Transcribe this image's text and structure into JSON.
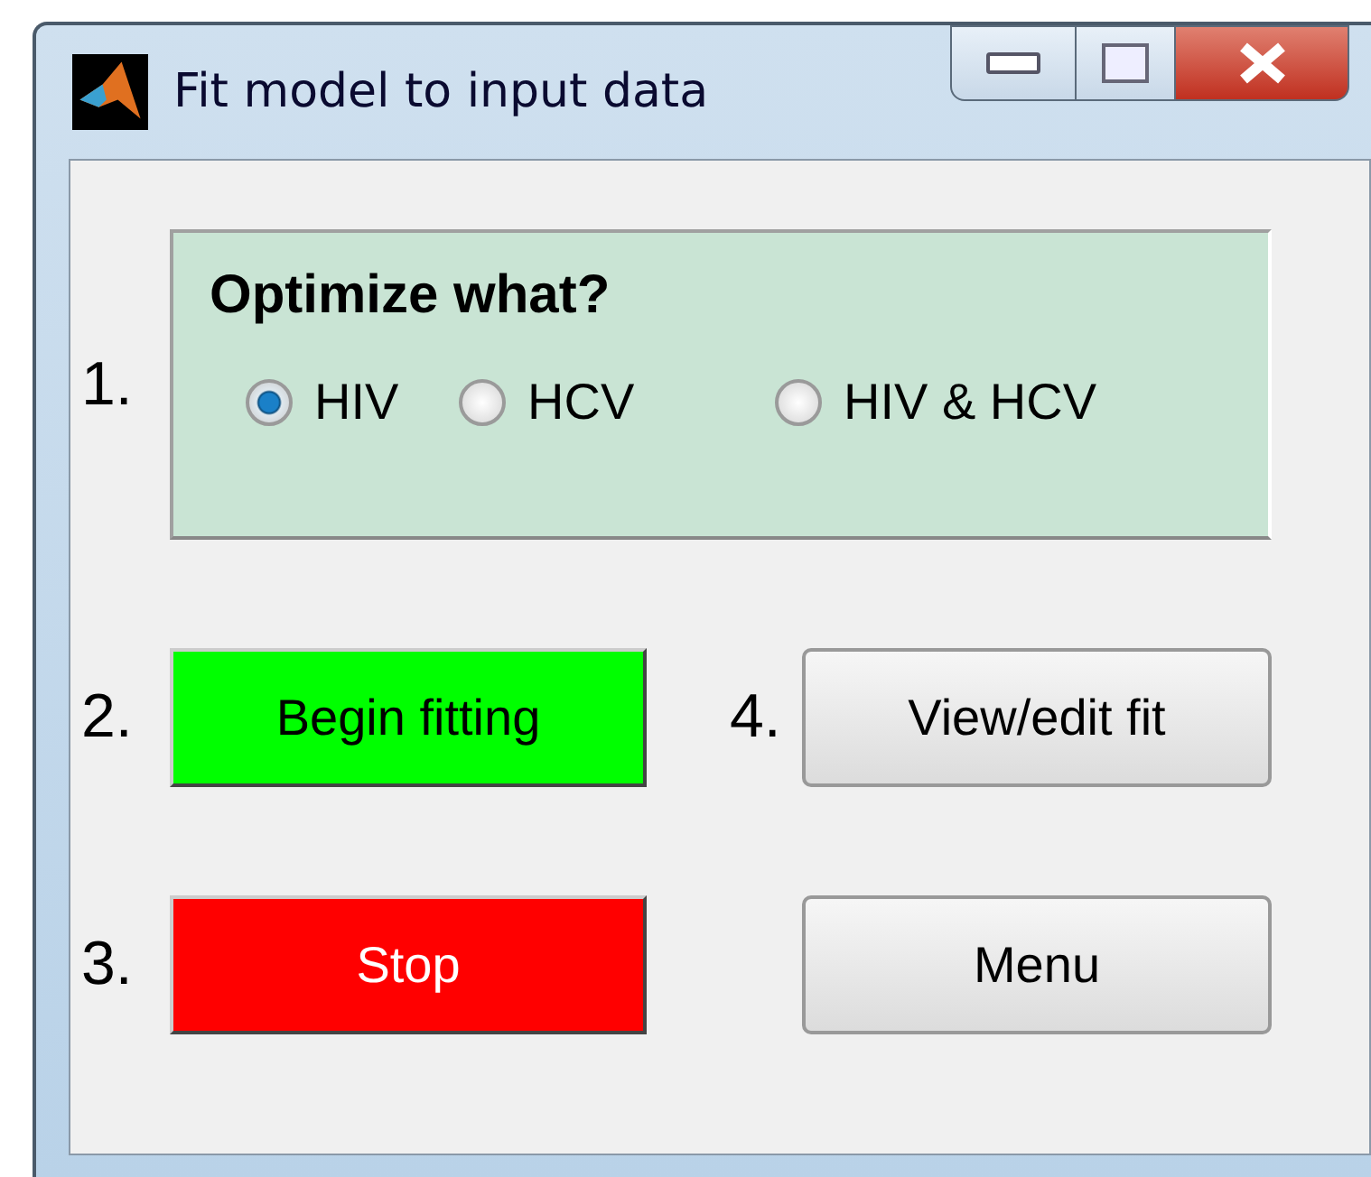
{
  "window": {
    "title": "Fit model to input data"
  },
  "panel": {
    "number": "1.",
    "heading": "Optimize what?",
    "options": [
      {
        "label": "HIV",
        "selected": true
      },
      {
        "label": "HCV",
        "selected": false
      },
      {
        "label": "HIV & HCV",
        "selected": false
      }
    ]
  },
  "buttons": [
    {
      "number": "2.",
      "label": "Begin fitting",
      "kind": "colored",
      "color": "#00ff00"
    },
    {
      "number": "4.",
      "label": "View/edit fit",
      "kind": "plain"
    },
    {
      "number": "3.",
      "label": "Stop",
      "kind": "colored",
      "color": "#ff0000"
    },
    {
      "label": "Menu",
      "kind": "plain"
    }
  ]
}
